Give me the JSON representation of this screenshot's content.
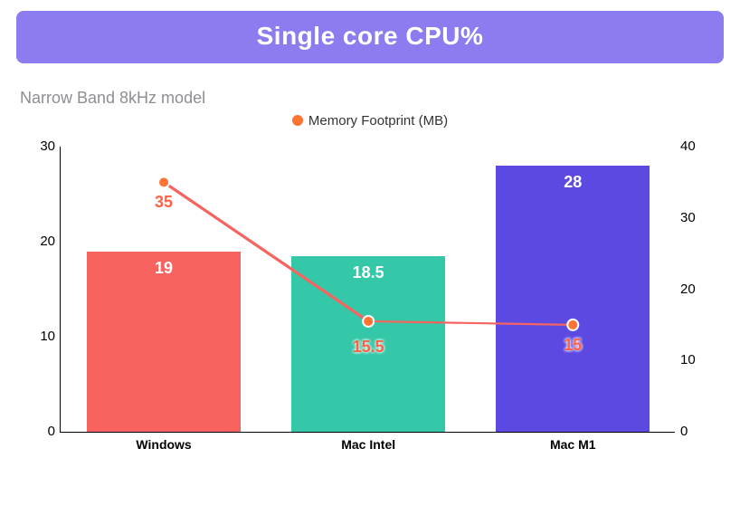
{
  "title": "Single core CPU%",
  "subtitle": "Narrow Band 8kHz model",
  "legend": {
    "memory": "Memory Footprint (MB)"
  },
  "left_axis": {
    "ticks": [
      0,
      10,
      20,
      30
    ]
  },
  "right_axis": {
    "ticks": [
      0,
      10,
      20,
      30,
      40
    ]
  },
  "categories": [
    "Windows",
    "Mac Intel",
    "Mac M1"
  ],
  "bar_labels": [
    "19",
    "18.5",
    "28"
  ],
  "memory_labels": [
    "35",
    "15.5",
    "15"
  ],
  "colors": {
    "title_bg": "#8B7CEF",
    "bar1": "#F76460",
    "bar2": "#35C8A8",
    "bar3": "#5C49E2",
    "line": "#F76460",
    "dot": "#ff7433"
  },
  "chart_data": {
    "type": "bar",
    "title": "Single core CPU%",
    "subtitle": "Narrow Band 8kHz model",
    "categories": [
      "Windows",
      "Mac Intel",
      "Mac M1"
    ],
    "series": [
      {
        "name": "Single core CPU%",
        "axis": "left",
        "type": "bar",
        "values": [
          19,
          18.5,
          28
        ]
      },
      {
        "name": "Memory Footprint (MB)",
        "axis": "right",
        "type": "line",
        "values": [
          35,
          15.5,
          15
        ]
      }
    ],
    "xlabel": "",
    "ylabel_left": "",
    "ylabel_right": "",
    "ylim_left": [
      0,
      30
    ],
    "ylim_right": [
      0,
      40
    ],
    "legend_position": "top"
  }
}
